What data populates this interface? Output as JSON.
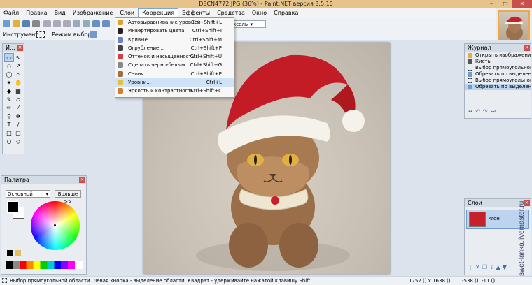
{
  "window": {
    "title": "DSCN4772.JPG (36%) - Paint.NET версия 3.5.10",
    "minimize": "–",
    "maximize": "□",
    "close": "✕"
  },
  "menu": [
    "Файл",
    "Правка",
    "Вид",
    "Изображение",
    "Слои",
    "Коррекция",
    "Эффекты",
    "Средства",
    "Окно",
    "Справка"
  ],
  "toolbar": {
    "tool_label": "Инструмент:",
    "selection_mode_label": "Режим выбора:",
    "units_value": "кселы"
  },
  "adjustments_menu": [
    {
      "label": "Автовыравнивание уровней",
      "shortcut": "Ctrl+Shift+L",
      "color": "#e0a030"
    },
    {
      "label": "Инвертировать цвета",
      "shortcut": "Ctrl+Shift+I",
      "color": "#222222"
    },
    {
      "label": "Кривые...",
      "shortcut": "Ctrl+Shift+M",
      "color": "#6a7fd0"
    },
    {
      "label": "Огрубление...",
      "shortcut": "Ctrl+Shift+P",
      "color": "#444444"
    },
    {
      "label": "Оттенок и насыщенность...",
      "shortcut": "Ctrl+Shift+U",
      "color": "#d04040"
    },
    {
      "label": "Сделать черно-белым",
      "shortcut": "Ctrl+Shift+G",
      "color": "#888888"
    },
    {
      "label": "Сепия",
      "shortcut": "Ctrl+Shift+E",
      "color": "#a07040"
    },
    {
      "label": "Уровни...",
      "shortcut": "Ctrl+L",
      "color": "#e0c040"
    },
    {
      "label": "Яркость и контрастность...",
      "shortcut": "Ctrl+Shift+C",
      "color": "#d08030"
    }
  ],
  "tools_panel": {
    "title": "И..."
  },
  "palette": {
    "title": "Палитра",
    "mode": "Основной",
    "more_button": "Больше >>"
  },
  "history": {
    "title": "Журнал",
    "items": [
      "Открыть изображение",
      "Кисть",
      "Выбор прямоугольной об...",
      "Обрезать по выделению",
      "Выбор прямоугольной об...",
      "Обрезать по выделению"
    ]
  },
  "layers": {
    "title": "Слои",
    "items": [
      "Фон"
    ]
  },
  "status": {
    "hint": "Выбор прямоугольной области. Левая кнопка - выделение области. Квадрат - удерживайте нажатой клавишу Shift.",
    "size": "1752 () x 1638 ()",
    "pos": "-538 (), -11 ()"
  },
  "watermark": "swet-lanka.livemaster.ru"
}
